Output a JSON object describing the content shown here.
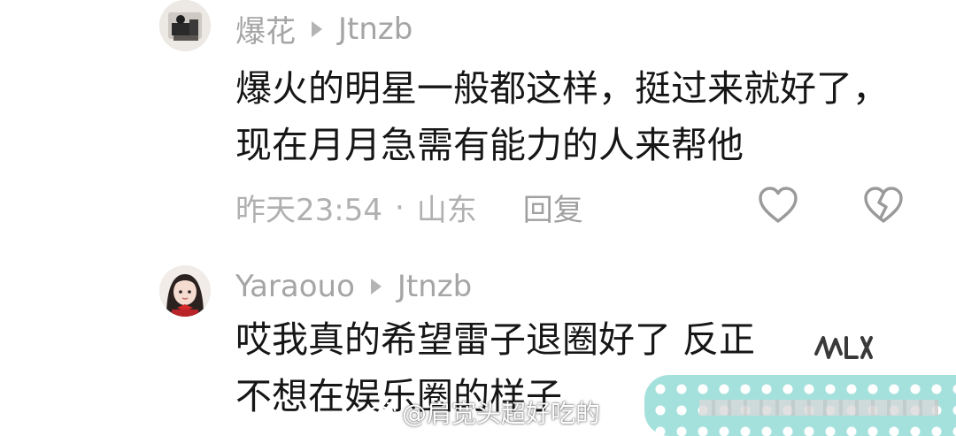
{
  "comments": [
    {
      "username": "爆花",
      "reply_to": "Jtnzb",
      "content_lines": [
        "爆火的明星一般都这样，挺过来就好了，",
        "现在月月急需有能力的人来帮他"
      ],
      "time": "昨天23:54",
      "separator": "·",
      "location": "山东",
      "reply_label": "回复",
      "avatar_icon": "avatar-dark-figure-icon",
      "like_icon": "heart-outline-icon",
      "dislike_icon": "broken-heart-icon"
    },
    {
      "username": "Yaraouo",
      "reply_to": "Jtnzb",
      "content_lines": [
        "哎我真的希望雷子退圈好了 反正",
        "不想在娱乐圈的样子"
      ],
      "avatar_icon": "avatar-girl-icon"
    }
  ],
  "watermark": {
    "text": "@肩宽头超好吃的",
    "logo_icon": "weibo-logo-icon"
  },
  "colors": {
    "username": "#a5a5a5",
    "content": "#161616",
    "meta": "#b0b0b0",
    "banner": "#a4e1dc"
  }
}
